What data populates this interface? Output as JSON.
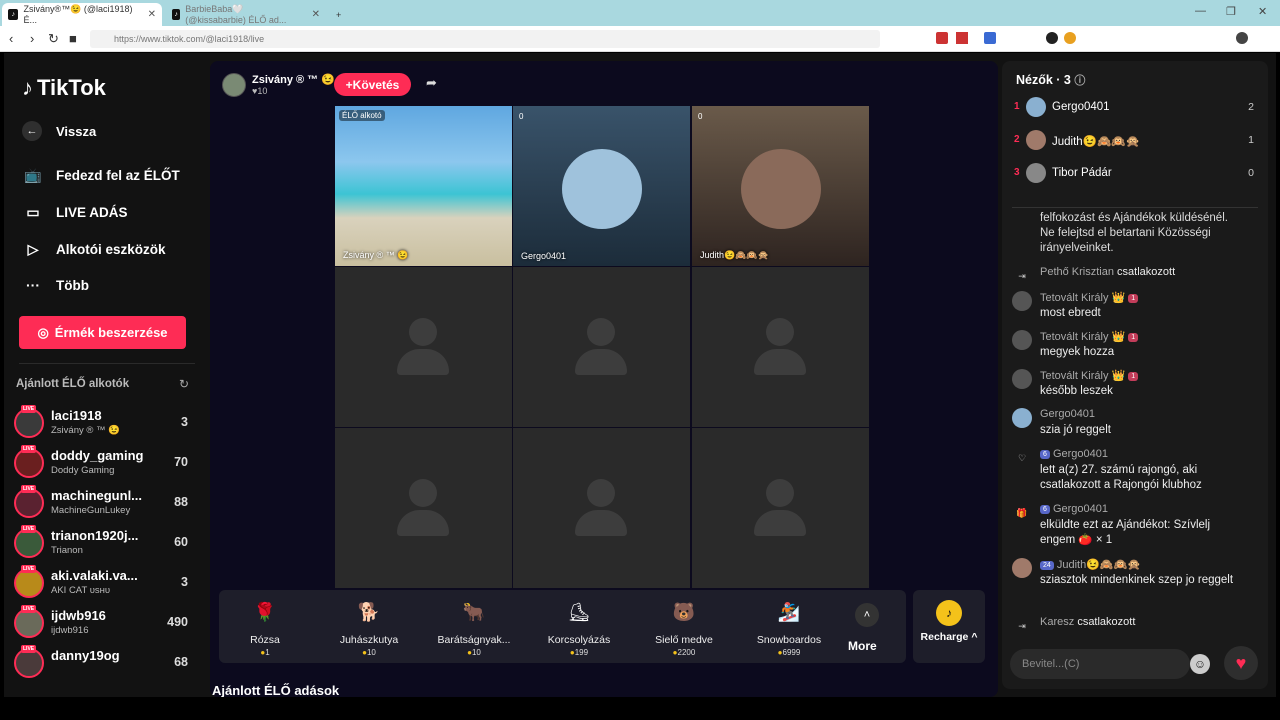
{
  "browser": {
    "tabs": [
      {
        "title": "Zsivány®™😉 (@laci1918) É...",
        "active": true
      },
      {
        "title": "BarbieBaba🤍 (@kissabarbie) ÉLŐ ad...",
        "active": false
      }
    ],
    "new_tab": "+",
    "url": "https://www.tiktok.com/@laci1918/live"
  },
  "sidebar": {
    "logo": "TikTok",
    "back": "Vissza",
    "nav": [
      {
        "label": "Fedezd fel az ÉLŐT",
        "icon": "live-tv-icon"
      },
      {
        "label": "LIVE ADÁS",
        "icon": "camera-icon"
      },
      {
        "label": "Alkotói eszközök",
        "icon": "creator-tools-icon"
      },
      {
        "label": "Több",
        "icon": "more-dots-icon"
      }
    ],
    "coins_button": "Érmék beszerzése",
    "recommended_title": "Ajánlott ÉLŐ alkotók",
    "creators": [
      {
        "name": "laci1918",
        "sub": "Zsivány ® ™ 😉",
        "count": "3"
      },
      {
        "name": "doddy_gaming",
        "sub": "Doddy Gaming",
        "count": "70"
      },
      {
        "name": "machinegunl...",
        "sub": "MachineGunLukey",
        "count": "88"
      },
      {
        "name": "trianon1920j...",
        "sub": "Trianon",
        "count": "60"
      },
      {
        "name": "aki.valaki.va...",
        "sub": "AKI CAT ᴜsʜᴜ",
        "count": "3"
      },
      {
        "name": "ijdwb916",
        "sub": "ijdwb916",
        "count": "490"
      },
      {
        "name": "danny19og",
        "sub": "",
        "count": "68"
      }
    ]
  },
  "stream": {
    "host_name": "Zsivány ® ™ 😉",
    "host_likes": "♥10",
    "follow_label": "+Követés",
    "cells": [
      {
        "tag": "ÉLŐ alkotó",
        "label": "Zsivány ® ™ 😉"
      },
      {
        "viewers": "0",
        "label": "Gergo0401"
      },
      {
        "viewers": "0",
        "label": "Judith😉🙈🙉🙊"
      }
    ],
    "gifts": [
      {
        "name": "Rózsa",
        "price": "1",
        "emoji": "🌹"
      },
      {
        "name": "Juhászkutya",
        "price": "10",
        "emoji": "🐕"
      },
      {
        "name": "Barátságnyak...",
        "price": "10",
        "emoji": "🐂"
      },
      {
        "name": "Korcsolyázás",
        "price": "199",
        "emoji": "⛸"
      },
      {
        "name": "Sielő medve",
        "price": "2200",
        "emoji": "🐻"
      },
      {
        "name": "Snowboardos",
        "price": "6999",
        "emoji": "🏂"
      }
    ],
    "more_label": "More",
    "recharge_label": "Recharge ^",
    "recommended_live": "Ajánlott ÉLŐ adások"
  },
  "viewers": {
    "title": "Nézők · 3",
    "list": [
      {
        "rank": "1",
        "name": "Gergo0401",
        "score": "2"
      },
      {
        "rank": "2",
        "name": "Judith😉🙈🙉🙊",
        "score": "1"
      },
      {
        "rank": "3",
        "name": "Tibor Pádár",
        "score": "0"
      }
    ]
  },
  "chat": {
    "messages": [
      {
        "name": "",
        "text": "felfokozást és Ajándékok küldésénél. Ne felejtsd el betartani Közösségi irányelveinket."
      },
      {
        "name": "Pethő Krisztian",
        "text": "csatlakozott",
        "inline": true
      },
      {
        "name": "Tetovált Király 👑",
        "badge": "1",
        "text": "most ebredt"
      },
      {
        "name": "Tetovált Király 👑",
        "badge": "1",
        "text": "megyek hozza"
      },
      {
        "name": "Tetovált Király 👑",
        "badge": "1",
        "text": "később leszek"
      },
      {
        "name": "Gergo0401",
        "badge": "",
        "text": "szia jó reggelt"
      },
      {
        "name": "Gergo0401",
        "badge": "6",
        "text": "lett a(z) 27. számú rajongó, aki csatlakozott a Rajongói klubhoz"
      },
      {
        "name": "Gergo0401",
        "badge": "6",
        "text": "elküldte ezt az Ajándékot: Szívlelj engem 🍅 × 1"
      },
      {
        "name": "Judith😉🙈🙉🙊",
        "badge": "24",
        "text": "sziasztok mindenkinek szep jo reggelt"
      },
      {
        "name": "Karesz",
        "text": "csatlakozott",
        "inline": true
      }
    ],
    "input_placeholder": "Bevitel...(C)"
  }
}
